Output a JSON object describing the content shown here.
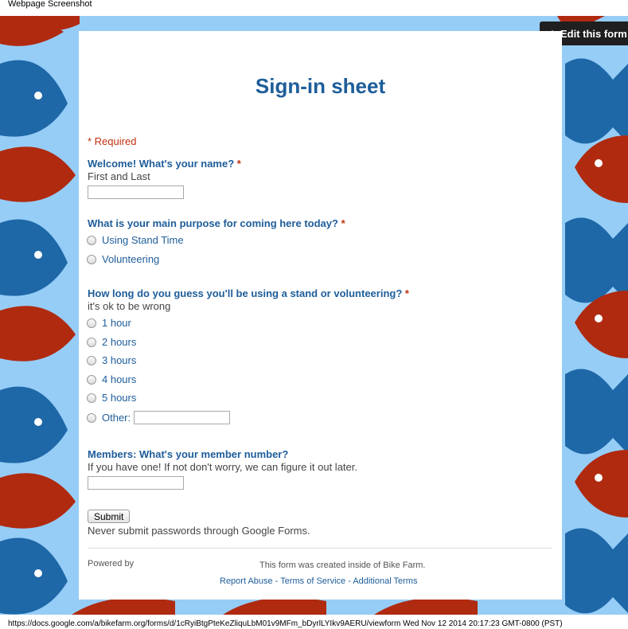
{
  "page_title": "Webpage Screenshot",
  "edit_button": {
    "label": "Edit this form",
    "icon": "pencil-icon"
  },
  "form": {
    "title": "Sign-in sheet",
    "required_note": "* Required",
    "q1": {
      "title": "Welcome! What's your name?",
      "star": "*",
      "help": "First and Last",
      "value": ""
    },
    "q2": {
      "title": "What is your main purpose for coming here today?",
      "star": "*",
      "options": [
        "Using Stand Time",
        "Volunteering"
      ]
    },
    "q3": {
      "title": "How long do you guess you'll be using a stand or volunteering?",
      "star": "*",
      "help": "it's ok to be wrong",
      "options": [
        "1 hour",
        "2 hours",
        "3 hours",
        "4 hours",
        "5 hours"
      ],
      "other_label": "Other:"
    },
    "q4": {
      "title": "Members: What's your member number?",
      "help": "If you have one! If not don't worry, we can figure it out later."
    },
    "submit_label": "Submit",
    "password_note": "Never submit passwords through Google Forms."
  },
  "footer": {
    "powered_by": "Powered by",
    "created_note": "This form was created inside of Bike Farm.",
    "links": [
      "Report Abuse",
      "Terms of Service",
      "Additional Terms"
    ],
    "separator": " - "
  },
  "status_line": "https://docs.google.com/a/bikefarm.org/forms/d/1cRyiBtgPteKeZliquLbM01v9MFm_bDyrlLYIkv9AERU/viewform Wed Nov 12 2014 20:17:23 GMT-0800 (PST)",
  "colors": {
    "background": "#96cdf7",
    "fish_blue": "#1e68a8",
    "fish_red": "#b02a10",
    "accent": "#1e5d9a"
  }
}
